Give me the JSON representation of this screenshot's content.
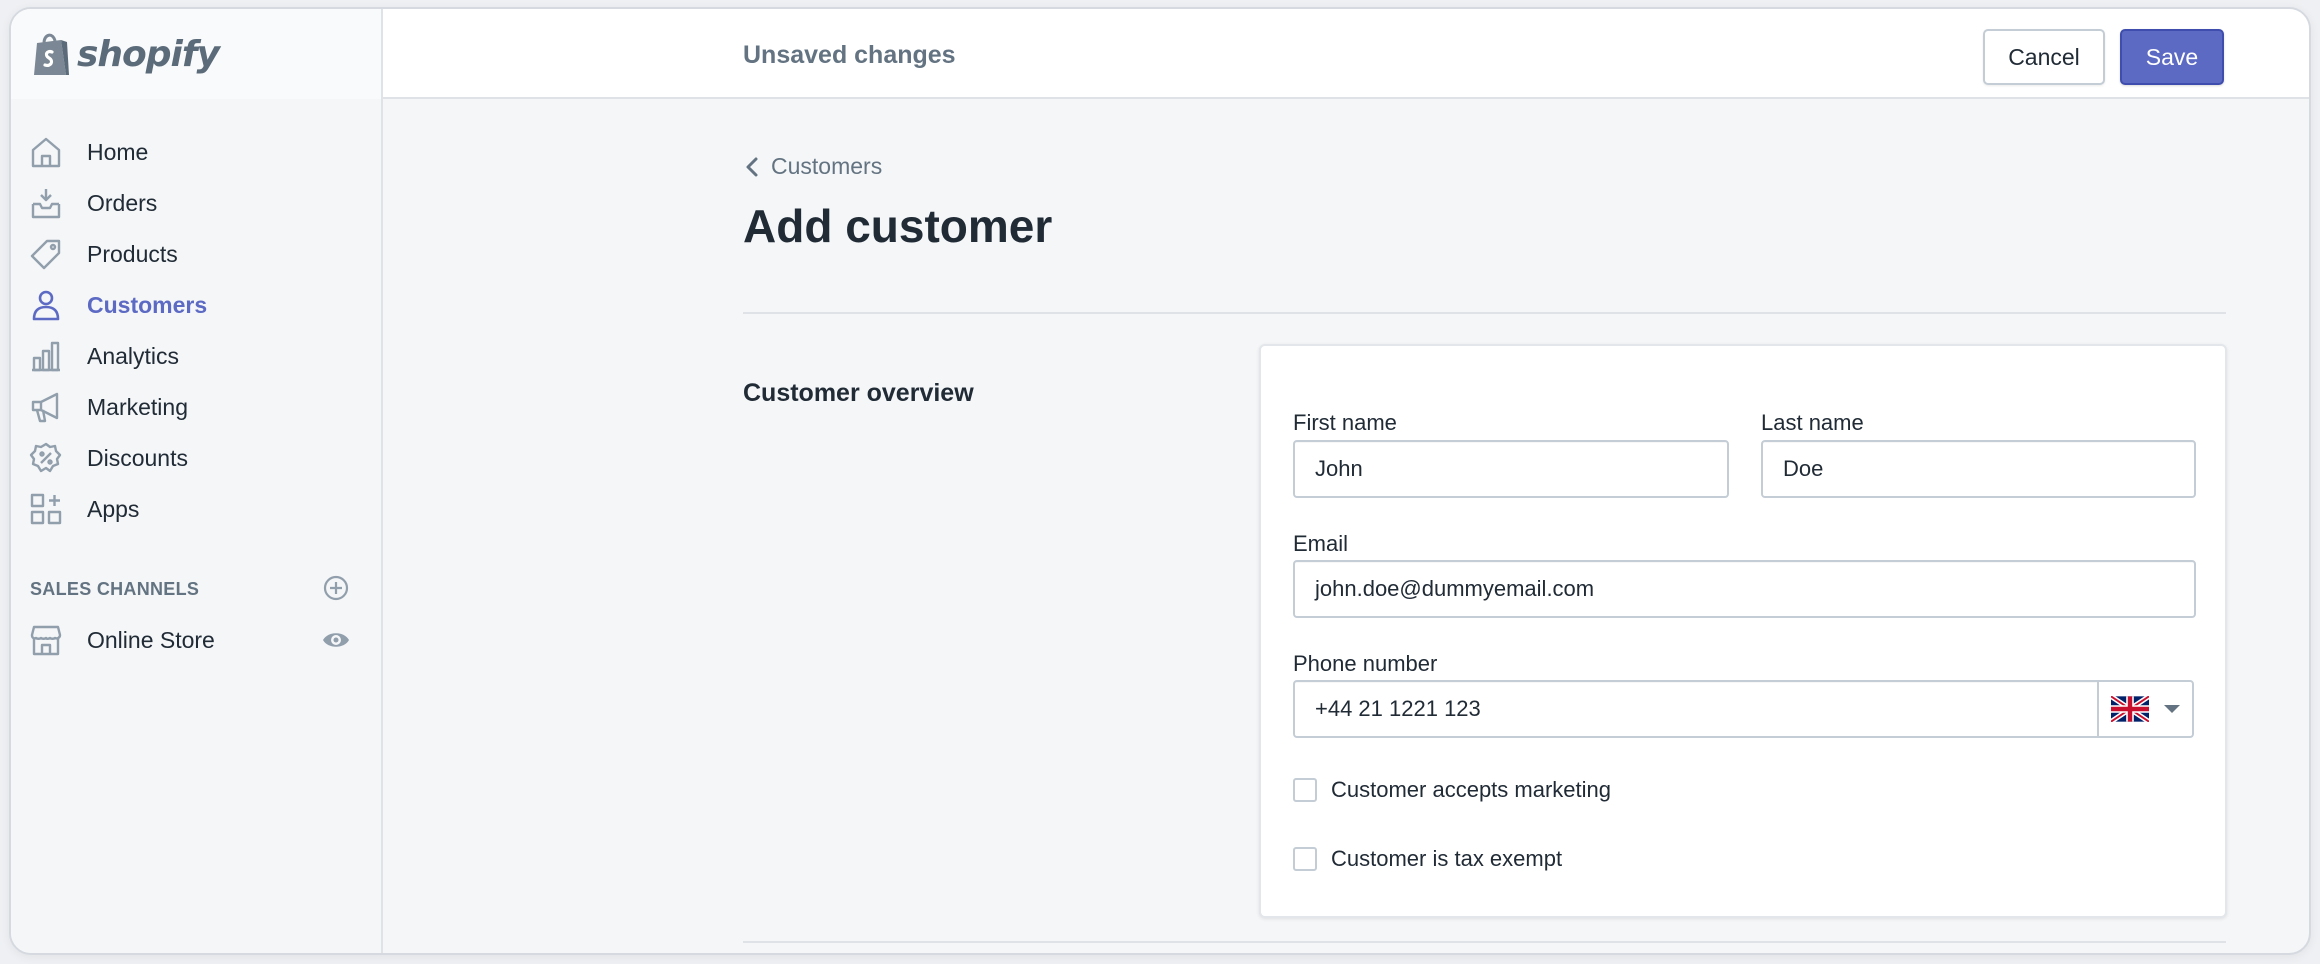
{
  "brand": {
    "name": "shopify"
  },
  "topbar": {
    "status": "Unsaved changes",
    "cancel_label": "Cancel",
    "save_label": "Save"
  },
  "nav": {
    "items": [
      {
        "label": "Home",
        "icon": "home-icon"
      },
      {
        "label": "Orders",
        "icon": "orders-icon"
      },
      {
        "label": "Products",
        "icon": "tag-icon"
      },
      {
        "label": "Customers",
        "icon": "person-icon",
        "active": true
      },
      {
        "label": "Analytics",
        "icon": "bar-chart-icon"
      },
      {
        "label": "Marketing",
        "icon": "megaphone-icon"
      },
      {
        "label": "Discounts",
        "icon": "discount-icon"
      },
      {
        "label": "Apps",
        "icon": "apps-icon"
      }
    ],
    "sales_channels_title": "SALES CHANNELS",
    "channels": [
      {
        "label": "Online Store",
        "icon": "store-icon"
      }
    ]
  },
  "page": {
    "breadcrumb": "Customers",
    "title": "Add customer",
    "section_title": "Customer overview"
  },
  "form": {
    "first_name_label": "First name",
    "first_name_value": "John",
    "last_name_label": "Last name",
    "last_name_value": "Doe",
    "email_label": "Email",
    "email_value": "john.doe@dummyemail.com",
    "phone_label": "Phone number",
    "phone_value": "+44 21 1221 123",
    "phone_country": "UK flag",
    "accepts_marketing_label": "Customer accepts marketing",
    "accepts_marketing_checked": false,
    "tax_exempt_label": "Customer is tax exempt",
    "tax_exempt_checked": false
  },
  "colors": {
    "accent": "#5c6ac4",
    "text": "#212b36",
    "muted": "#637381",
    "border": "#c4cdd5",
    "background": "#f4f6f8"
  }
}
